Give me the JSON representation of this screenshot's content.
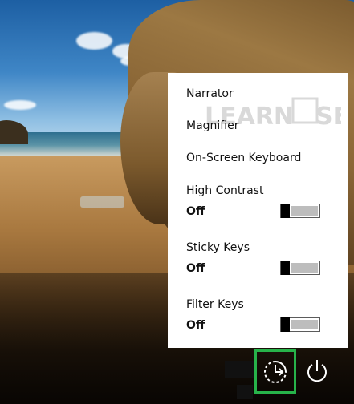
{
  "flyout": {
    "items": [
      {
        "label": "Narrator"
      },
      {
        "label": "Magnifier"
      },
      {
        "label": "On-Screen Keyboard"
      }
    ],
    "toggles": [
      {
        "label": "High Contrast",
        "state": "Off"
      },
      {
        "label": "Sticky Keys",
        "state": "Off"
      },
      {
        "label": "Filter Keys",
        "state": "Off"
      }
    ]
  },
  "watermark": {
    "text_left": "LEARN",
    "text_right": "SE"
  },
  "bottom_bar": {
    "ease_of_access_icon": "ease-of-access-icon",
    "power_icon": "power-icon",
    "highlight_color": "#27b34a"
  }
}
